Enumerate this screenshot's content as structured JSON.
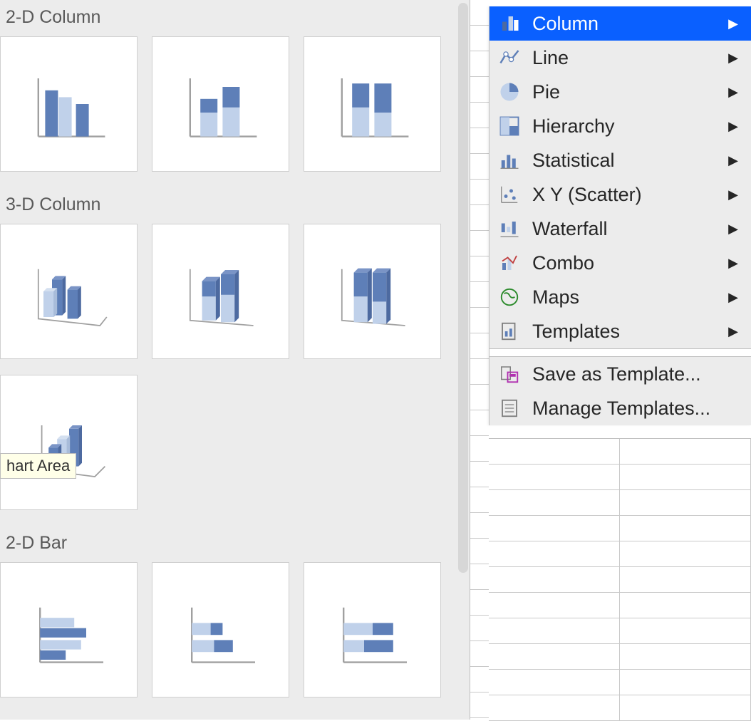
{
  "gallery": {
    "sections": [
      {
        "id": "2d-col",
        "title": "2-D Column"
      },
      {
        "id": "3d-col",
        "title": "3-D Column"
      },
      {
        "id": "2d-bar",
        "title": "2-D Bar"
      }
    ]
  },
  "tooltip": {
    "text": "hart Area"
  },
  "menu": {
    "items": [
      {
        "id": "column",
        "label": "Column",
        "submenu": true,
        "selected": true
      },
      {
        "id": "line",
        "label": "Line",
        "submenu": true
      },
      {
        "id": "pie",
        "label": "Pie",
        "submenu": true
      },
      {
        "id": "hierarchy",
        "label": "Hierarchy",
        "submenu": true
      },
      {
        "id": "statistical",
        "label": "Statistical",
        "submenu": true
      },
      {
        "id": "scatter",
        "label": "X Y (Scatter)",
        "submenu": true
      },
      {
        "id": "waterfall",
        "label": "Waterfall",
        "submenu": true
      },
      {
        "id": "combo",
        "label": "Combo",
        "submenu": true
      },
      {
        "id": "maps",
        "label": "Maps",
        "submenu": true
      },
      {
        "id": "templates",
        "label": "Templates",
        "submenu": true
      }
    ],
    "footer": [
      {
        "id": "save-template",
        "label": "Save as Template..."
      },
      {
        "id": "manage-templates",
        "label": "Manage Templates..."
      }
    ]
  },
  "colors": {
    "accent": "#0a60ff",
    "bar_dark": "#5e7fb8",
    "bar_light": "#c0d1ea"
  }
}
